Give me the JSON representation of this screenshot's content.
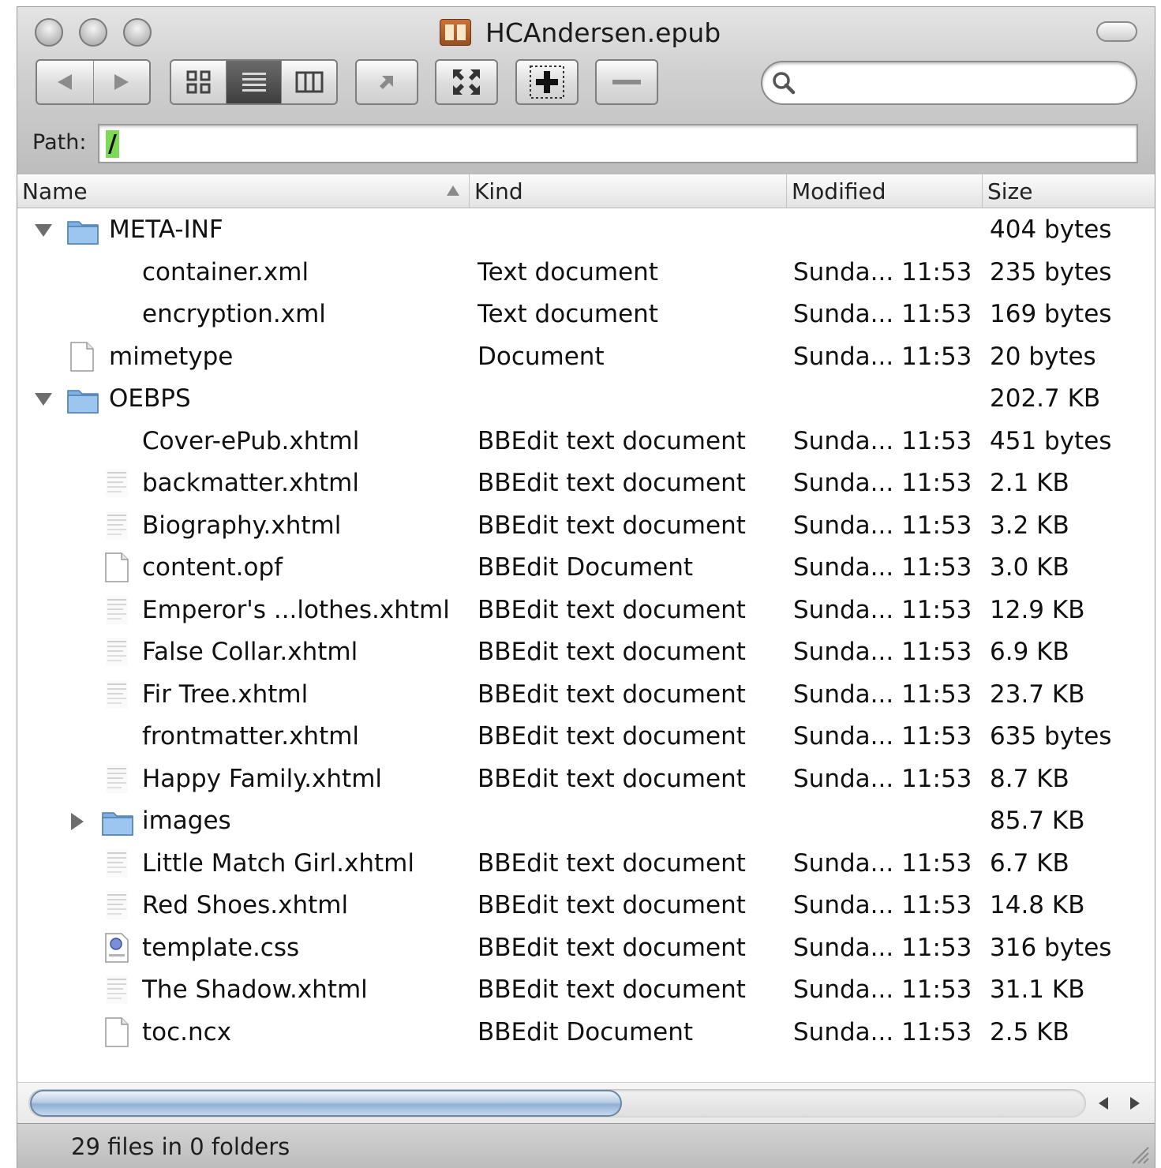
{
  "window": {
    "title": "HCAndersen.epub",
    "path_label": "Path:",
    "path_value": "/",
    "search_placeholder": ""
  },
  "columns": {
    "name": "Name",
    "kind": "Kind",
    "modified": "Modified",
    "size": "Size"
  },
  "rows": [
    {
      "name": "META-INF",
      "kind": "",
      "modified": "",
      "size": "404 bytes",
      "icon": "folder-icon",
      "disclosure": "expanded"
    },
    {
      "name": "container.xml",
      "kind": "Text document",
      "modified": "Sunda... 11:53",
      "size": "235 bytes",
      "icon": "none"
    },
    {
      "name": "encryption.xml",
      "kind": "Text document",
      "modified": "Sunda... 11:53",
      "size": "169 bytes",
      "icon": "none"
    },
    {
      "name": "mimetype",
      "kind": "Document",
      "modified": "Sunda... 11:53",
      "size": "20 bytes",
      "icon": "document-icon"
    },
    {
      "name": "OEBPS",
      "kind": "",
      "modified": "",
      "size": "202.7 KB",
      "icon": "folder-icon",
      "disclosure": "expanded"
    },
    {
      "name": "Cover-ePub.xhtml",
      "kind": "BBEdit text document",
      "modified": "Sunda... 11:53",
      "size": "451 bytes",
      "icon": "none"
    },
    {
      "name": "backmatter.xhtml",
      "kind": "BBEdit text document",
      "modified": "Sunda... 11:53",
      "size": "2.1 KB",
      "icon": "text-file-icon"
    },
    {
      "name": "Biography.xhtml",
      "kind": "BBEdit text document",
      "modified": "Sunda... 11:53",
      "size": "3.2 KB",
      "icon": "text-file-icon"
    },
    {
      "name": "content.opf",
      "kind": "BBEdit Document",
      "modified": "Sunda... 11:53",
      "size": "3.0 KB",
      "icon": "document-icon"
    },
    {
      "name": "Emperor's ...lothes.xhtml",
      "kind": "BBEdit text document",
      "modified": "Sunda... 11:53",
      "size": "12.9 KB",
      "icon": "text-file-icon"
    },
    {
      "name": "False Collar.xhtml",
      "kind": "BBEdit text document",
      "modified": "Sunda... 11:53",
      "size": "6.9 KB",
      "icon": "text-file-icon"
    },
    {
      "name": "Fir Tree.xhtml",
      "kind": "BBEdit text document",
      "modified": "Sunda... 11:53",
      "size": "23.7 KB",
      "icon": "text-file-icon"
    },
    {
      "name": "frontmatter.xhtml",
      "kind": "BBEdit text document",
      "modified": "Sunda... 11:53",
      "size": "635 bytes",
      "icon": "none"
    },
    {
      "name": "Happy Family.xhtml",
      "kind": "BBEdit text document",
      "modified": "Sunda... 11:53",
      "size": "8.7 KB",
      "icon": "text-file-icon"
    },
    {
      "name": "images",
      "kind": "",
      "modified": "",
      "size": "85.7 KB",
      "icon": "folder-icon",
      "disclosure": "collapsed"
    },
    {
      "name": "Little Match Girl.xhtml",
      "kind": "BBEdit text document",
      "modified": "Sunda... 11:53",
      "size": "6.7 KB",
      "icon": "text-file-icon"
    },
    {
      "name": "Red Shoes.xhtml",
      "kind": "BBEdit text document",
      "modified": "Sunda... 11:53",
      "size": "14.8 KB",
      "icon": "text-file-icon"
    },
    {
      "name": "template.css",
      "kind": "BBEdit text document",
      "modified": "Sunda... 11:53",
      "size": "316 bytes",
      "icon": "css-file-icon"
    },
    {
      "name": "The Shadow.xhtml",
      "kind": "BBEdit text document",
      "modified": "Sunda... 11:53",
      "size": "31.1 KB",
      "icon": "text-file-icon"
    },
    {
      "name": "toc.ncx",
      "kind": "BBEdit Document",
      "modified": "Sunda... 11:53",
      "size": "2.5 KB",
      "icon": "document-icon"
    }
  ],
  "status": {
    "text": "29 files in 0 folders"
  },
  "colors": {
    "path_highlight": "#7ed957",
    "scroll_thumb": "#8fb0d4"
  }
}
